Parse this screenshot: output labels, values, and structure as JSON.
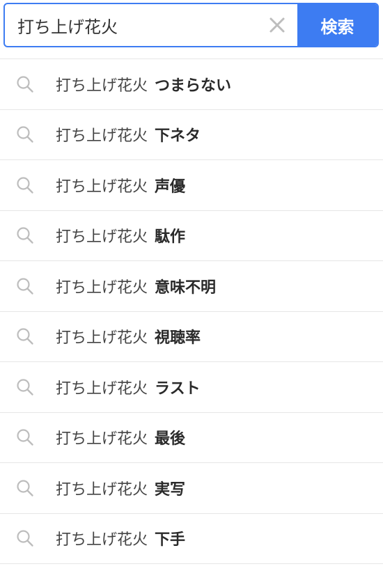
{
  "search": {
    "value": "打ち上げ花火",
    "button_label": "検索"
  },
  "icons": {
    "clear": "close-icon",
    "suggestion": "search-icon"
  },
  "colors": {
    "accent": "#3d7cf2",
    "divider": "#e6e6e6",
    "icon": "#bdbdbd"
  },
  "suggestions": [
    {
      "term": "打ち上げ花火",
      "suffix": "つまらない"
    },
    {
      "term": "打ち上げ花火",
      "suffix": "下ネタ"
    },
    {
      "term": "打ち上げ花火",
      "suffix": "声優"
    },
    {
      "term": "打ち上げ花火",
      "suffix": "駄作"
    },
    {
      "term": "打ち上げ花火",
      "suffix": "意味不明"
    },
    {
      "term": "打ち上げ花火",
      "suffix": "視聴率"
    },
    {
      "term": "打ち上げ花火",
      "suffix": "ラスト"
    },
    {
      "term": "打ち上げ花火",
      "suffix": "最後"
    },
    {
      "term": "打ち上げ花火",
      "suffix": "実写"
    },
    {
      "term": "打ち上げ花火",
      "suffix": "下手"
    }
  ]
}
